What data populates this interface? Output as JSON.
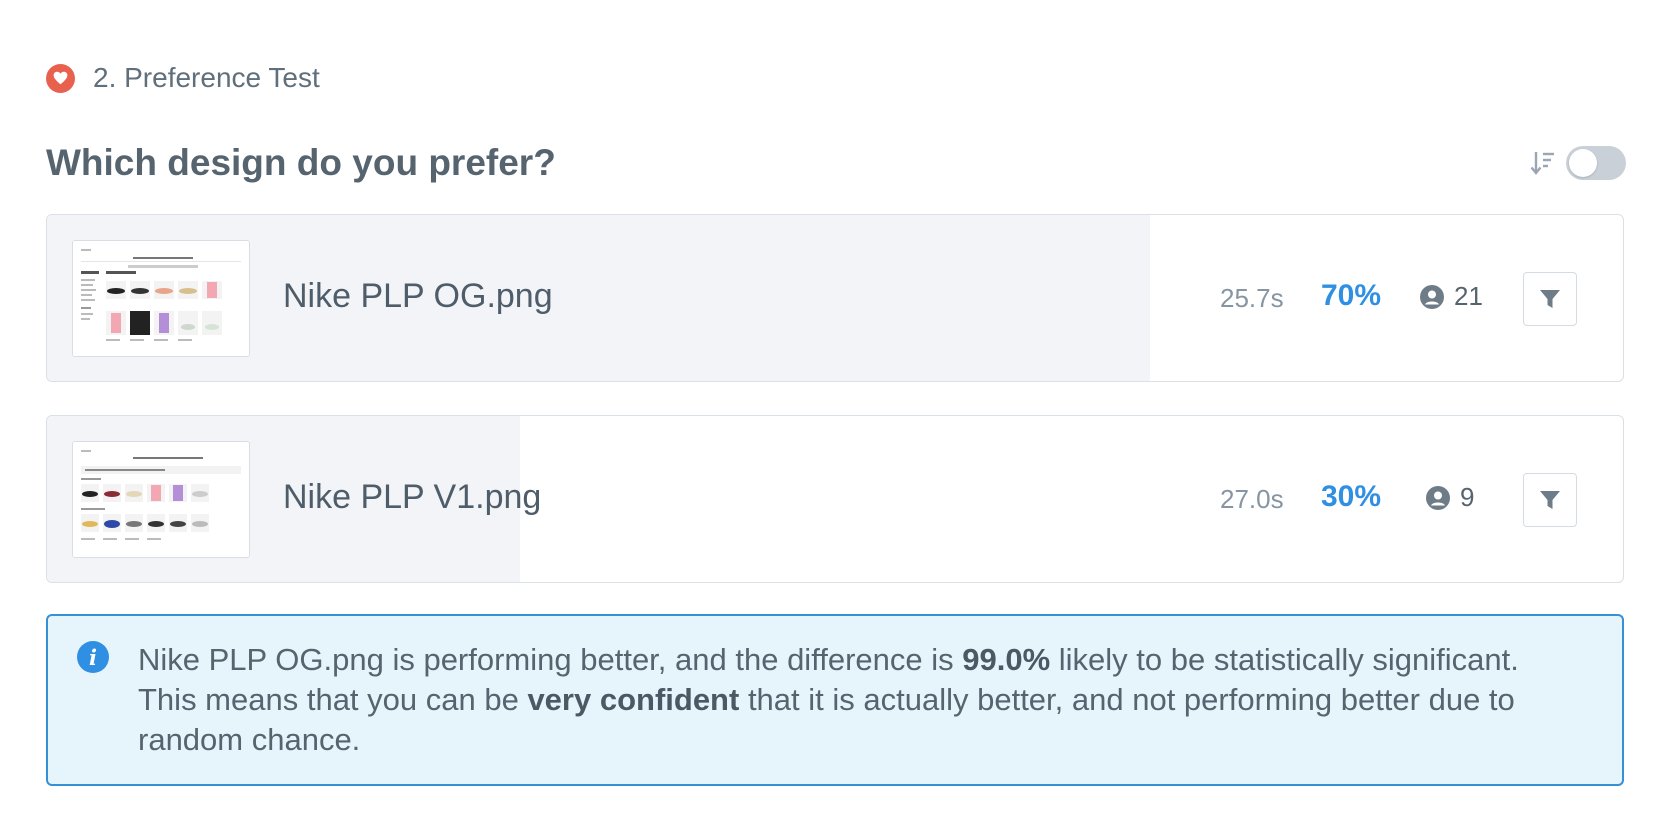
{
  "section": {
    "number_title": "2. Preference Test",
    "icon": "heart-icon"
  },
  "question": "Which design do you prefer?",
  "colors": {
    "accent": "#2f8fe3",
    "heart_badge": "#e8614f",
    "row_fill": "#f2f4f8",
    "info_bg": "#e6f4fc",
    "info_border": "#3590d6"
  },
  "options": [
    {
      "name": "Nike PLP OG.png",
      "avg_time": "25.7s",
      "percent": "70%",
      "share": 0.7,
      "users": "21"
    },
    {
      "name": "Nike PLP V1.png",
      "avg_time": "27.0s",
      "percent": "30%",
      "share": 0.3,
      "users": "9"
    }
  ],
  "insight": {
    "part1": "Nike PLP OG.png is performing better, and the difference is ",
    "confidence": "99.0%",
    "part2": " likely to be statistically significant. This means that you can be ",
    "confidence_label": "very confident",
    "part3": " that it is actually better, and not performing better due to random chance."
  }
}
